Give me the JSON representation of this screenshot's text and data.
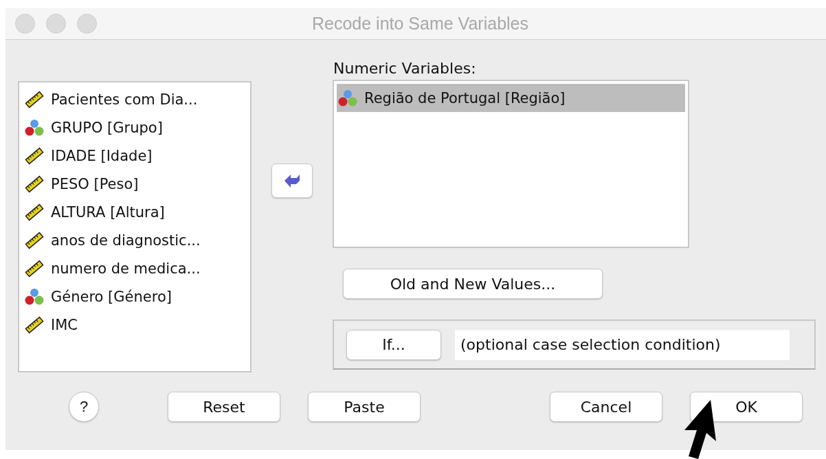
{
  "window": {
    "title": "Recode into Same Variables"
  },
  "source_variables": [
    {
      "label": "Pacientes com Dia...",
      "kind": "scale",
      "selected": false
    },
    {
      "label": "GRUPO [Grupo]",
      "kind": "nominal",
      "selected": false
    },
    {
      "label": "IDADE [Idade]",
      "kind": "scale",
      "selected": false
    },
    {
      "label": "PESO [Peso]",
      "kind": "scale",
      "selected": false
    },
    {
      "label": "ALTURA [Altura]",
      "kind": "scale",
      "selected": false
    },
    {
      "label": "anos de diagnostic...",
      "kind": "scale",
      "selected": false
    },
    {
      "label": "numero de medica...",
      "kind": "scale",
      "selected": false
    },
    {
      "label": "Género [Género]",
      "kind": "nominal",
      "selected": false
    },
    {
      "label": "IMC",
      "kind": "scale",
      "selected": false
    }
  ],
  "numeric_variables": {
    "label": "Numeric Variables:",
    "items": [
      {
        "label": "Região de Portugal [Região]",
        "kind": "nominal",
        "selected": true
      }
    ]
  },
  "old_new_button": "Old and New Values...",
  "if_button": "If...",
  "condition_text": "(optional case selection condition)",
  "help_button": "?",
  "buttons": [
    "Reset",
    "Paste",
    "Cancel",
    "OK"
  ]
}
